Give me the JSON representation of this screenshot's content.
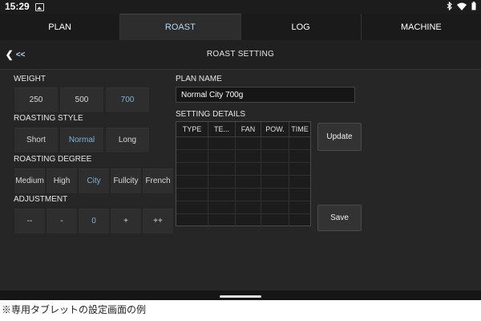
{
  "status_bar": {
    "time": "15:29"
  },
  "tabs": [
    {
      "label": "PLAN",
      "active": false
    },
    {
      "label": "ROAST",
      "active": true
    },
    {
      "label": "LOG",
      "active": false
    },
    {
      "label": "MACHINE",
      "active": false
    }
  ],
  "header": {
    "back_label": "<<",
    "title": "ROAST SETTING"
  },
  "weight": {
    "label": "WEIGHT",
    "options": [
      "250",
      "500",
      "700"
    ],
    "selected": "700"
  },
  "roasting_style": {
    "label": "ROASTING STYLE",
    "options": [
      "Short",
      "Normal",
      "Long"
    ],
    "selected": "Normal"
  },
  "roasting_degree": {
    "label": "ROASTING DEGREE",
    "options": [
      "Medium",
      "High",
      "City",
      "Fullcity",
      "French"
    ],
    "selected": "City"
  },
  "adjustment": {
    "label": "ADJUSTMENT",
    "options": [
      "--",
      "-",
      "0",
      "+",
      "++"
    ],
    "selected": "0"
  },
  "plan_name": {
    "label": "PLAN NAME",
    "value": "Normal City 700g"
  },
  "setting_details": {
    "label": "SETTING DETAILS",
    "columns": [
      "TYPE",
      "TE...",
      "FAN",
      "POW.",
      "TIME"
    ]
  },
  "buttons": {
    "update": "Update",
    "save": "Save"
  },
  "caption": "※専用タブレットの設定画面の例",
  "colors": {
    "accent": "#7fb2d6",
    "background": "#262626"
  }
}
